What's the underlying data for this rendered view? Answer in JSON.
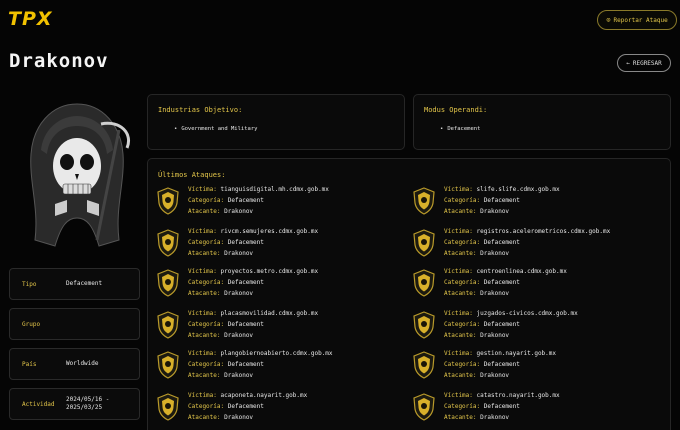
{
  "brand": {
    "logo": "TPX"
  },
  "header": {
    "report_label": "Reportar Ataque"
  },
  "page": {
    "title": "Drakonov",
    "back_label": "REGRESAR"
  },
  "info": [
    {
      "key": "Tipo",
      "value": "Defacement"
    },
    {
      "key": "Grupo",
      "value": ""
    },
    {
      "key": "País",
      "value": "Worldwide"
    },
    {
      "key": "Actividad",
      "value": "2024/05/16 - 2025/03/25"
    }
  ],
  "industries": {
    "title": "Industrias Objetivo:",
    "items": [
      "Government and Military"
    ]
  },
  "modus": {
    "title": "Modus Operandi:",
    "items": [
      "Defacement"
    ]
  },
  "attacks": {
    "title": "Últimos Ataques:",
    "labels": {
      "victim": "Víctima:",
      "category": "Categoría:",
      "attacker": "Atacante:"
    },
    "left": [
      {
        "victim": "tianguisdigital.mh.cdmx.gob.mx",
        "category": "Defacement",
        "attacker": "Drakonov"
      },
      {
        "victim": "rivcm.semujeres.cdmx.gob.mx",
        "category": "Defacement",
        "attacker": "Drakonov"
      },
      {
        "victim": "proyectos.metro.cdmx.gob.mx",
        "category": "Defacement",
        "attacker": "Drakonov"
      },
      {
        "victim": "placasmovilidad.cdmx.gob.mx",
        "category": "Defacement",
        "attacker": "Drakonov"
      },
      {
        "victim": "plangobiernoabierto.cdmx.gob.mx",
        "category": "Defacement",
        "attacker": "Drakonov"
      },
      {
        "victim": "acaponeta.nayarit.gob.mx",
        "category": "Defacement",
        "attacker": "Drakonov"
      }
    ],
    "right": [
      {
        "victim": "slife.slife.cdmx.gob.mx",
        "category": "Defacement",
        "attacker": "Drakonov"
      },
      {
        "victim": "registros.acelerometricos.cdmx.gob.mx",
        "category": "Defacement",
        "attacker": "Drakonov"
      },
      {
        "victim": "centroenlinea.cdmx.gob.mx",
        "category": "Defacement",
        "attacker": "Drakonov"
      },
      {
        "victim": "juzgados-civicos.cdmx.gob.mx",
        "category": "Defacement",
        "attacker": "Drakonov"
      },
      {
        "victim": "gestion.nayarit.gob.mx",
        "category": "Defacement",
        "attacker": "Drakonov"
      },
      {
        "victim": "catastro.nayarit.gob.mx",
        "category": "Defacement",
        "attacker": "Drakonov"
      }
    ]
  },
  "colors": {
    "accent": "#e3c64a",
    "brand": "#f2c200",
    "background": "#050505"
  }
}
